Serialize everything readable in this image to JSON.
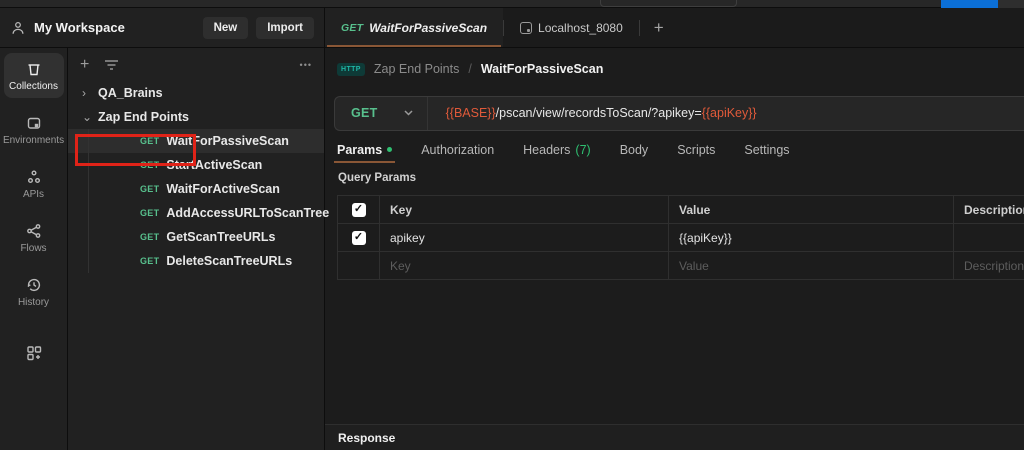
{
  "colors": {
    "method_get_green": "#58c08d",
    "variable_orange": "#e05a3a",
    "annotation_red": "#e02318",
    "active_underline_orange": "#8a5736",
    "status_dot_green": "#2fbf71",
    "http_badge_teal": "#1fb6a6",
    "topbar_fragment_blue": "#0b6fd7"
  },
  "icons": {
    "checkmark": "✓",
    "plus": "+",
    "more_options": "•••",
    "chevron_right": "›",
    "chevron_down": "⌄",
    "add_tab": "+"
  },
  "workspace_header": {
    "title": "My Workspace",
    "new_button_label": "New",
    "import_button_label": "Import"
  },
  "activity_bar": {
    "items": [
      {
        "label": "Collections",
        "active": true
      },
      {
        "label": "Environments",
        "active": false
      },
      {
        "label": "APIs",
        "active": false
      },
      {
        "label": "Flows",
        "active": false
      },
      {
        "label": "History",
        "active": false
      }
    ]
  },
  "sidebar": {
    "tree": {
      "collections": [
        {
          "label": "QA_Brains",
          "expanded": false
        },
        {
          "label": "Zap End Points",
          "expanded": true
        }
      ],
      "requests": [
        {
          "method": "GET",
          "label": "WaitForPassiveScan",
          "selected": true
        },
        {
          "method": "GET",
          "label": "StartActiveScan",
          "selected": false
        },
        {
          "method": "GET",
          "label": "WaitForActiveScan",
          "selected": false
        },
        {
          "method": "GET",
          "label": "AddAccessURLToScanTree",
          "selected": false
        },
        {
          "method": "GET",
          "label": "GetScanTreeURLs",
          "selected": false
        },
        {
          "method": "GET",
          "label": "DeleteScanTreeURLs",
          "selected": false
        }
      ]
    }
  },
  "annotation": {
    "type": "red-highlight-box",
    "target": "Zap End Points"
  },
  "main_tabs": {
    "tabs": [
      {
        "method": "GET",
        "label": "WaitForPassiveScan",
        "active": true
      },
      {
        "label": "Localhost_8080",
        "active": false
      }
    ]
  },
  "breadcrumb": {
    "protocol_badge": "HTTP",
    "collection": "Zap End Points",
    "separator": "/",
    "request": "WaitForPassiveScan"
  },
  "request_bar": {
    "method": "GET",
    "url_base_variable": "{{BASE}}",
    "url_path": "/pscan/view/recordsToScan/?apikey=",
    "url_value_variable": "{{apiKey}}"
  },
  "request_tabs": {
    "items": [
      {
        "label": "Params",
        "active": true
      },
      {
        "label": "Authorization",
        "active": false
      },
      {
        "label": "Headers",
        "count": "(7)",
        "active": false
      },
      {
        "label": "Body",
        "active": false
      },
      {
        "label": "Scripts",
        "active": false
      },
      {
        "label": "Settings",
        "active": false
      }
    ]
  },
  "query_params": {
    "section_label": "Query Params",
    "columns": {
      "key": "Key",
      "value": "Value",
      "description": "Description"
    },
    "rows": [
      {
        "key": "apikey",
        "value": "{{apiKey}}",
        "description": "",
        "checked": true
      }
    ],
    "placeholder_row": {
      "key": "Key",
      "value": "Value",
      "description": "Description"
    }
  },
  "response": {
    "section_label": "Response"
  }
}
